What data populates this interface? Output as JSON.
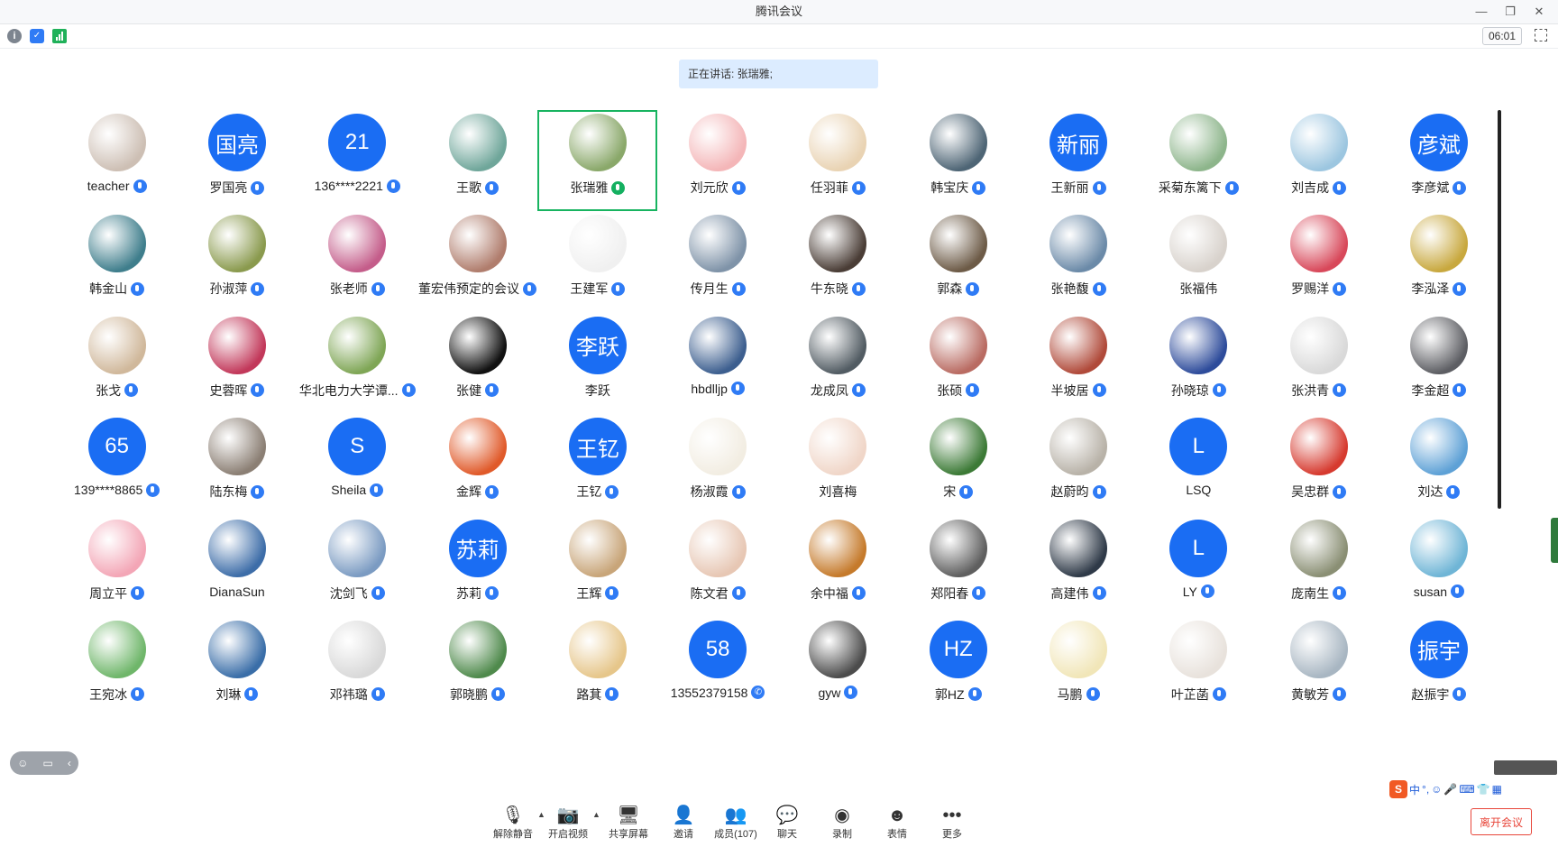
{
  "window": {
    "title": "腾讯会议",
    "controls": [
      "—",
      "❐",
      "✕"
    ]
  },
  "infobar": {
    "timer": "06:01"
  },
  "speaking": "正在讲话: 张瑞雅;",
  "participants": [
    {
      "name": "teacher",
      "avatar_type": "img",
      "color": "#cdbfb4",
      "mic": "on"
    },
    {
      "name": "罗国亮",
      "avatar_type": "text",
      "avatar_text": "国亮",
      "mic": "on"
    },
    {
      "name": "136****2221",
      "avatar_type": "text",
      "avatar_text": "21",
      "mic": "on"
    },
    {
      "name": "王歌",
      "avatar_type": "img",
      "color": "#6fa69a",
      "mic": "on"
    },
    {
      "name": "张瑞雅",
      "avatar_type": "img",
      "color": "#8aa86a",
      "mic": "speaking",
      "active": true
    },
    {
      "name": "刘元欣",
      "avatar_type": "img",
      "color": "#f4b6b8",
      "mic": "on"
    },
    {
      "name": "任羽菲",
      "avatar_type": "img",
      "color": "#e9d3b3",
      "mic": "on"
    },
    {
      "name": "韩宝庆",
      "avatar_type": "img",
      "color": "#4e6575",
      "mic": "on"
    },
    {
      "name": "王新丽",
      "avatar_type": "text",
      "avatar_text": "新丽",
      "mic": "on"
    },
    {
      "name": "采菊东篱下",
      "avatar_type": "img",
      "color": "#8db58b",
      "mic": "on"
    },
    {
      "name": "刘吉成",
      "avatar_type": "img",
      "color": "#9cc6e0",
      "mic": "on"
    },
    {
      "name": "李彦斌",
      "avatar_type": "text",
      "avatar_text": "彦斌",
      "mic": "on"
    },
    {
      "name": "韩金山",
      "avatar_type": "img",
      "color": "#3f7e8c",
      "mic": "on"
    },
    {
      "name": "孙淑萍",
      "avatar_type": "img",
      "color": "#8a9a4e",
      "mic": "on"
    },
    {
      "name": "张老师",
      "avatar_type": "img",
      "color": "#c45d8a",
      "mic": "on"
    },
    {
      "name": "董宏伟预定的会议",
      "avatar_type": "img",
      "color": "#b07d6d",
      "mic": "on"
    },
    {
      "name": "王建军",
      "avatar_type": "img",
      "color": "#f0f0f0",
      "mic": "on"
    },
    {
      "name": "传月生",
      "avatar_type": "img",
      "color": "#7f93a8",
      "mic": "on"
    },
    {
      "name": "牛东晓",
      "avatar_type": "img",
      "color": "#4a3d36",
      "mic": "on"
    },
    {
      "name": "郭森",
      "avatar_type": "img",
      "color": "#6d5b47",
      "mic": "on"
    },
    {
      "name": "张艳馥",
      "avatar_type": "img",
      "color": "#6b8aa8",
      "mic": "on"
    },
    {
      "name": "张福伟",
      "avatar_type": "img",
      "color": "#d8d2cc",
      "mic": "off"
    },
    {
      "name": "罗赐洋",
      "avatar_type": "img",
      "color": "#d8485a",
      "mic": "on"
    },
    {
      "name": "李泓泽",
      "avatar_type": "img",
      "color": "#c8a83e",
      "mic": "on"
    },
    {
      "name": "张戈",
      "avatar_type": "img",
      "color": "#d0b89b",
      "mic": "on"
    },
    {
      "name": "史蓉晖",
      "avatar_type": "img",
      "color": "#c2385a",
      "mic": "on"
    },
    {
      "name": "华北电力大学谭...",
      "avatar_type": "img",
      "color": "#7fa656",
      "mic": "on"
    },
    {
      "name": "张健",
      "avatar_type": "img",
      "color": "#111111",
      "mic": "on"
    },
    {
      "name": "李跃",
      "avatar_type": "text",
      "avatar_text": "李跃",
      "mic": "off"
    },
    {
      "name": "hbdlljp",
      "avatar_type": "img",
      "color": "#3d5f8f",
      "mic": "on"
    },
    {
      "name": "龙成凤",
      "avatar_type": "img",
      "color": "#525c63",
      "mic": "on"
    },
    {
      "name": "张硕",
      "avatar_type": "img",
      "color": "#b96b62",
      "mic": "on"
    },
    {
      "name": "半坡居",
      "avatar_type": "img",
      "color": "#b04a3a",
      "mic": "on"
    },
    {
      "name": "孙晓琼",
      "avatar_type": "img",
      "color": "#2e4c9b",
      "mic": "on"
    },
    {
      "name": "张洪青",
      "avatar_type": "img",
      "color": "#d9d9d9",
      "mic": "on"
    },
    {
      "name": "李金超",
      "avatar_type": "img",
      "color": "#5d5e63",
      "mic": "on"
    },
    {
      "name": "139****8865",
      "avatar_type": "text",
      "avatar_text": "65",
      "mic": "on"
    },
    {
      "name": "陆东梅",
      "avatar_type": "img",
      "color": "#8b7f74",
      "mic": "on"
    },
    {
      "name": "Sheila",
      "avatar_type": "text",
      "avatar_text": "S",
      "mic": "on"
    },
    {
      "name": "金辉",
      "avatar_type": "img",
      "color": "#e05a2a",
      "mic": "on"
    },
    {
      "name": "王钇",
      "avatar_type": "text",
      "avatar_text": "王钇",
      "mic": "on"
    },
    {
      "name": "杨淑霞",
      "avatar_type": "img",
      "color": "#f2ede2",
      "mic": "on"
    },
    {
      "name": "刘喜梅",
      "avatar_type": "img",
      "color": "#f0d6c8",
      "mic": "off"
    },
    {
      "name": "宋",
      "avatar_type": "img",
      "color": "#3c7a36",
      "mic": "on"
    },
    {
      "name": "赵蔚昀",
      "avatar_type": "img",
      "color": "#b8b2a8",
      "mic": "on"
    },
    {
      "name": "LSQ",
      "avatar_type": "text",
      "avatar_text": "L",
      "mic": "off"
    },
    {
      "name": "吴忠群",
      "avatar_type": "img",
      "color": "#d63a2f",
      "mic": "on"
    },
    {
      "name": "刘达",
      "avatar_type": "img",
      "color": "#5ea1d6",
      "mic": "on"
    },
    {
      "name": "周立平",
      "avatar_type": "img",
      "color": "#f3a6b6",
      "mic": "on"
    },
    {
      "name": "DianaSun",
      "avatar_type": "img",
      "color": "#3d6da8",
      "mic": "off"
    },
    {
      "name": "沈剑飞",
      "avatar_type": "img",
      "color": "#7b9bc2",
      "mic": "on"
    },
    {
      "name": "苏莉",
      "avatar_type": "text",
      "avatar_text": "苏莉",
      "mic": "on"
    },
    {
      "name": "王辉",
      "avatar_type": "img",
      "color": "#c8a579",
      "mic": "on"
    },
    {
      "name": "陈文君",
      "avatar_type": "img",
      "color": "#e7c7b4",
      "mic": "on"
    },
    {
      "name": "余中福",
      "avatar_type": "img",
      "color": "#c57a2b",
      "mic": "on"
    },
    {
      "name": "郑阳春",
      "avatar_type": "img",
      "color": "#5f5f5f",
      "mic": "on"
    },
    {
      "name": "高建伟",
      "avatar_type": "img",
      "color": "#2f3a48",
      "mic": "on"
    },
    {
      "name": "LY",
      "avatar_type": "text",
      "avatar_text": "L",
      "mic": "on"
    },
    {
      "name": "庞南生",
      "avatar_type": "img",
      "color": "#8a8f74",
      "mic": "on"
    },
    {
      "name": "susan",
      "avatar_type": "img",
      "color": "#6fb5d6",
      "mic": "on"
    },
    {
      "name": "王宛冰",
      "avatar_type": "img",
      "color": "#6fb66a",
      "mic": "on"
    },
    {
      "name": "刘琳",
      "avatar_type": "img",
      "color": "#3a6ea8",
      "mic": "on"
    },
    {
      "name": "邓祎璐",
      "avatar_type": "img",
      "color": "#d9d9d9",
      "mic": "on"
    },
    {
      "name": "郭晓鹏",
      "avatar_type": "img",
      "color": "#4f8a4c",
      "mic": "on"
    },
    {
      "name": "路萁",
      "avatar_type": "img",
      "color": "#e6c68a",
      "mic": "on"
    },
    {
      "name": "13552379158",
      "avatar_type": "text",
      "avatar_text": "58",
      "mic": "phone"
    },
    {
      "name": "gyw",
      "avatar_type": "img",
      "color": "#4c4c4c",
      "mic": "on"
    },
    {
      "name": "郭HZ",
      "avatar_type": "text",
      "avatar_text": "HZ",
      "mic": "on"
    },
    {
      "name": "马鹏",
      "avatar_type": "img",
      "color": "#f1e6b8",
      "mic": "on"
    },
    {
      "name": "叶芷菡",
      "avatar_type": "img",
      "color": "#e8e2dc",
      "mic": "on"
    },
    {
      "name": "黄敏芳",
      "avatar_type": "img",
      "color": "#a8b6c2",
      "mic": "on"
    },
    {
      "name": "赵振宇",
      "avatar_type": "text",
      "avatar_text": "振宇",
      "mic": "on"
    }
  ],
  "toolbar": {
    "unmute": "解除静音",
    "video": "开启视频",
    "share": "共享屏幕",
    "invite": "邀请",
    "members": "成员(107)",
    "chat": "聊天",
    "record": "录制",
    "emoji": "表情",
    "more": "更多",
    "leave": "离开会议"
  },
  "ime": {
    "logo": "S",
    "lang": "中"
  }
}
